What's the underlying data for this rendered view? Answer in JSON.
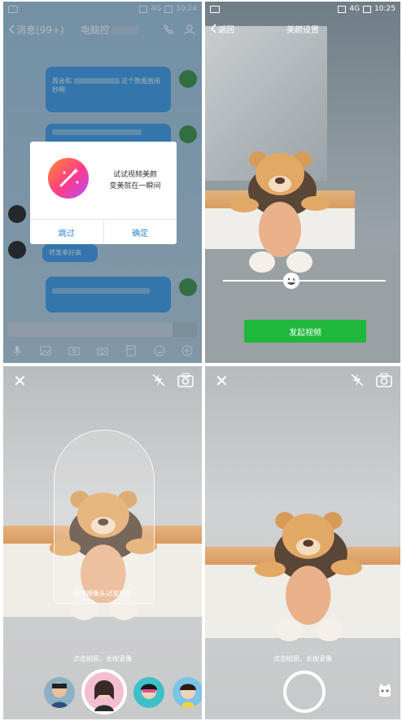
{
  "panel_chat": {
    "status": {
      "time": "10:24",
      "network": "4G"
    },
    "header": {
      "back_label": "消息(99+)",
      "title": "电脑控"
    },
    "messages": [
      {
        "text_pre": "周会和",
        "text_post": "这个数据直接秒啊"
      },
      {
        "text": "转发率好高"
      }
    ],
    "dialog": {
      "line1": "试试视频美颜",
      "line2": "变美就在一瞬间",
      "skip_label": "跳过",
      "ok_label": "确定"
    }
  },
  "panel_beauty": {
    "status": {
      "time": "10:25",
      "network": "4G"
    },
    "header": {
      "back_label": "返回",
      "title": "美颜设置"
    },
    "slider": {
      "value": 0.42
    },
    "start_button_label": "发起视频"
  },
  "panel_camera_face": {
    "face_hint": "请将摄像头对准脸部",
    "capture_hint": "点击拍照，长按录像"
  },
  "panel_camera_plain": {
    "capture_hint": "点击拍照，长按录像"
  },
  "colors": {
    "chat_blue": "#3b9be6",
    "green_button": "#1fb83d",
    "link_blue": "#2e86d8"
  }
}
